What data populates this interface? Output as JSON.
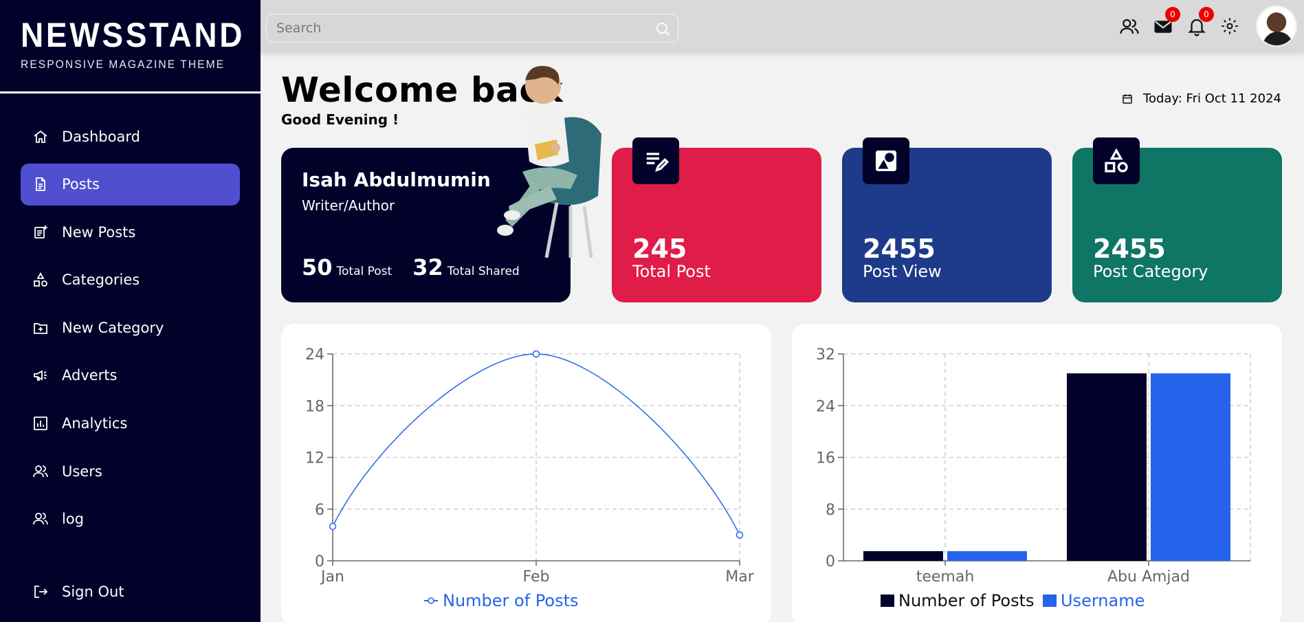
{
  "brand": {
    "name": "NEWSSTAND",
    "tagline": "RESPONSIVE MAGAZINE THEME"
  },
  "sidebar": {
    "items": [
      {
        "label": "Dashboard",
        "icon": "home-icon",
        "active": false
      },
      {
        "label": "Posts",
        "icon": "document-icon",
        "active": true
      },
      {
        "label": "New Posts",
        "icon": "new-post-icon",
        "active": false
      },
      {
        "label": "Categories",
        "icon": "shapes-icon",
        "active": false
      },
      {
        "label": "New Category",
        "icon": "folder-plus-icon",
        "active": false
      },
      {
        "label": "Adverts",
        "icon": "megaphone-icon",
        "active": false
      },
      {
        "label": "Analytics",
        "icon": "analytics-icon",
        "active": false
      },
      {
        "label": "Users",
        "icon": "users-icon",
        "active": false
      },
      {
        "label": "log",
        "icon": "users-icon",
        "active": false
      }
    ],
    "signout": {
      "label": "Sign Out",
      "icon": "sign-out-icon"
    }
  },
  "header": {
    "search_placeholder": "Search",
    "messages_badge": "0",
    "notifications_badge": "0"
  },
  "welcome": {
    "title": "Welcome back",
    "greeting": "Good Evening !",
    "today": "Today: Fri Oct 11 2024"
  },
  "profile": {
    "name": "Isah Abdulmumin",
    "role": "Writer/Author",
    "total_post_value": "50",
    "total_post_label": "Total Post",
    "total_shared_value": "32",
    "total_shared_label": "Total Shared"
  },
  "stats": [
    {
      "value": "245",
      "label": "Total Post",
      "color": "#e01c48",
      "icon": "edit-list-icon"
    },
    {
      "value": "2455",
      "label": "Post View",
      "color": "#1e3a8a",
      "icon": "shapes-card-icon"
    },
    {
      "value": "2455",
      "label": "Post Category",
      "color": "#0f7564",
      "icon": "category-shapes-icon"
    }
  ],
  "chart_data": [
    {
      "type": "line",
      "categories": [
        "Jan",
        "Feb",
        "Mar"
      ],
      "series": [
        {
          "name": "Number of Posts",
          "values": [
            4,
            24,
            3
          ],
          "color": "#2563eb"
        }
      ],
      "yticks": [
        0,
        6,
        12,
        18,
        24
      ],
      "ylim": [
        0,
        24
      ],
      "grid": true,
      "legend": "bottom"
    },
    {
      "type": "bar",
      "categories": [
        "teemah",
        "Abu Amjad"
      ],
      "series": [
        {
          "name": "Number of Posts",
          "values": [
            1.5,
            29
          ],
          "color": "#01012a"
        },
        {
          "name": "Username",
          "values": [
            1.5,
            29
          ],
          "color": "#2563eb"
        }
      ],
      "yticks": [
        0,
        8,
        16,
        24,
        32
      ],
      "ylim": [
        0,
        32
      ],
      "grid": true,
      "legend": "bottom"
    }
  ]
}
